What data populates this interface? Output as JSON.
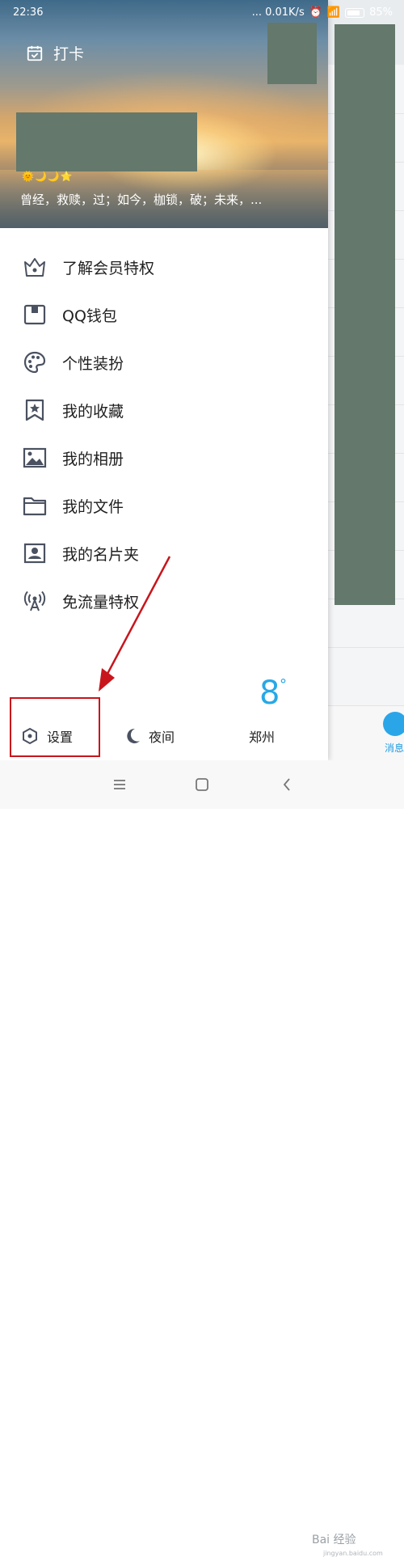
{
  "status_bar": {
    "time": "22:36",
    "network_speed": "... 0.01K/s",
    "battery": "85%"
  },
  "header": {
    "checkin_label": "打卡",
    "badges": "🌞🌙🌙⭐",
    "signature": "曾经，救赎，过；如今，枷锁，破；未来，..."
  },
  "menu": {
    "items": [
      {
        "label": "了解会员特权",
        "icon": "crown-icon"
      },
      {
        "label": "QQ钱包",
        "icon": "wallet-icon"
      },
      {
        "label": "个性装扮",
        "icon": "palette-icon"
      },
      {
        "label": "我的收藏",
        "icon": "bookmark-star-icon"
      },
      {
        "label": "我的相册",
        "icon": "image-icon"
      },
      {
        "label": "我的文件",
        "icon": "folder-icon"
      },
      {
        "label": "我的名片夹",
        "icon": "contact-card-icon"
      },
      {
        "label": "免流量特权",
        "icon": "antenna-icon"
      }
    ]
  },
  "bottom_bar": {
    "settings_label": "设置",
    "night_label": "夜间",
    "weather_temp": "8",
    "weather_unit": "°",
    "weather_city": "郑州"
  },
  "background_app": {
    "tab_label": "消息"
  },
  "watermark": {
    "text": "Bai 经验",
    "sub": "jingyan.baidu.com"
  },
  "colors": {
    "highlight_box": "#c8151c",
    "arrow": "#c8151c",
    "weather": "#28a8e6",
    "redacted_block": "#64786b"
  }
}
